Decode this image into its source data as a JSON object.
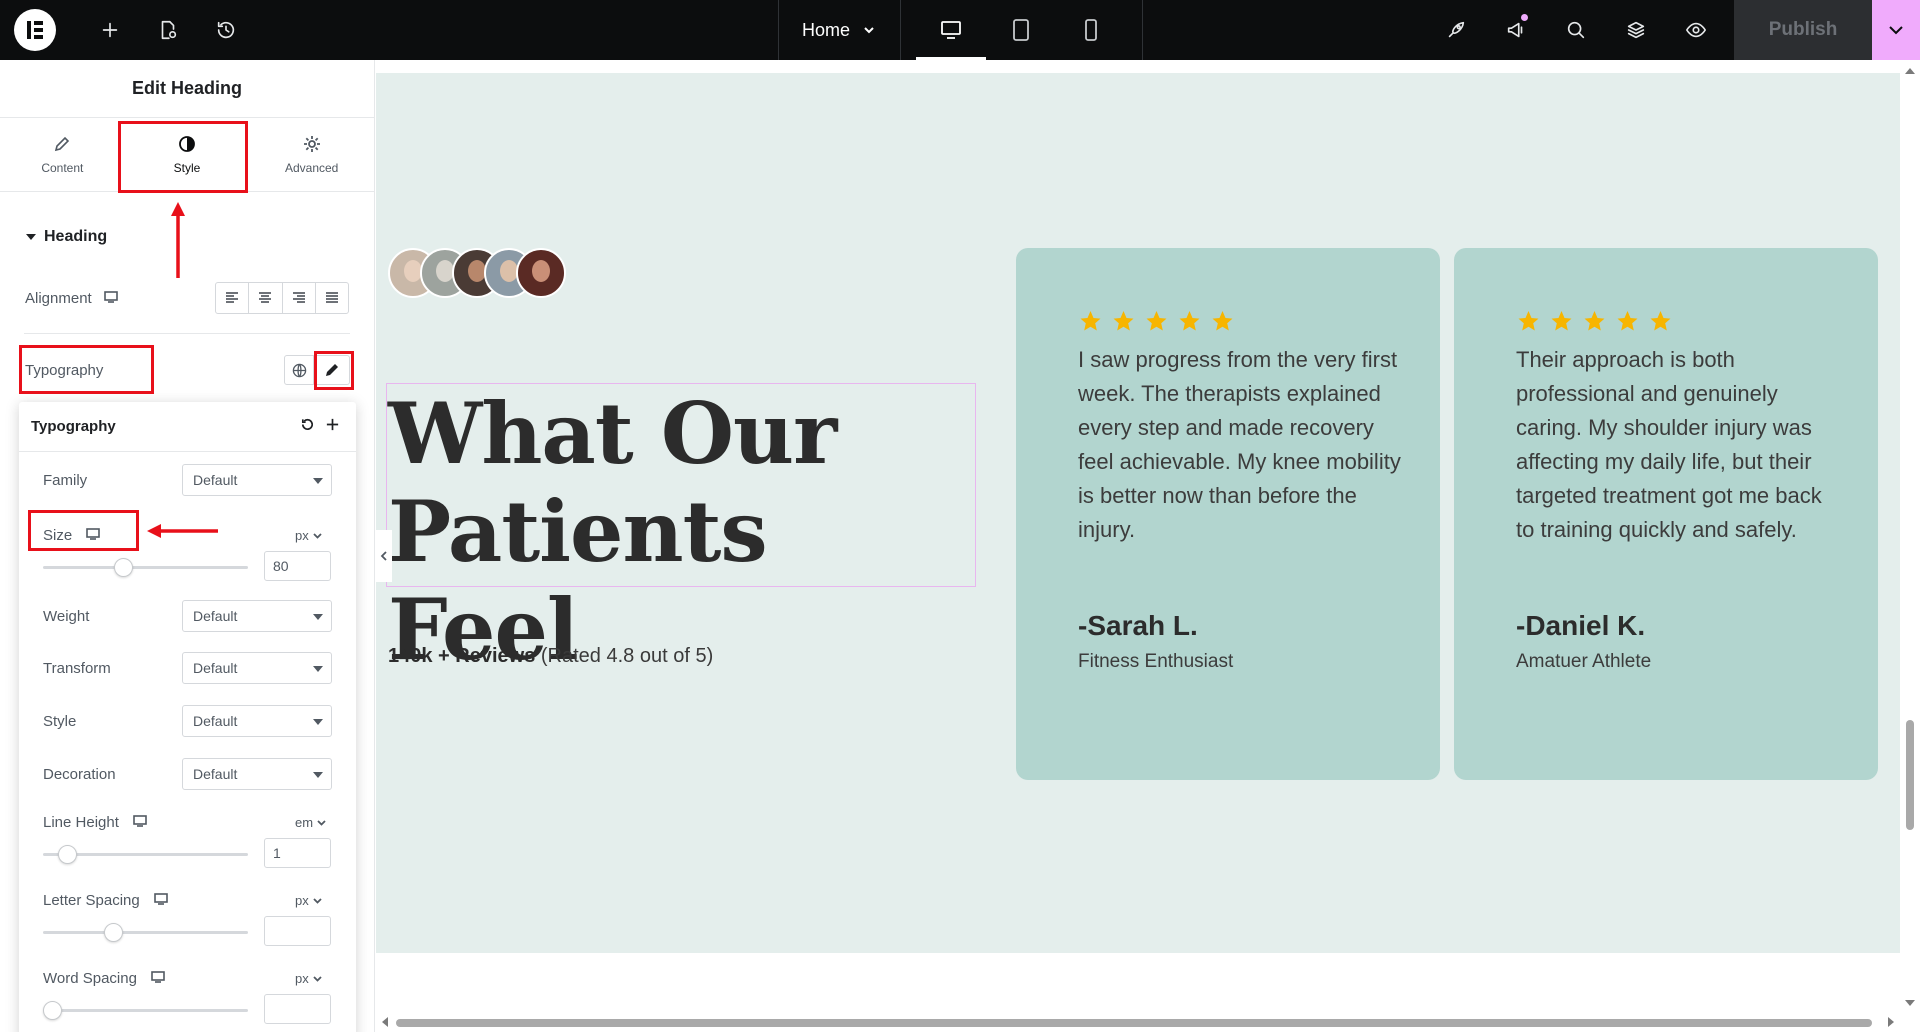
{
  "topbar": {
    "page_select": "Home",
    "publish_label": "Publish",
    "colors": {
      "bar": "#0c0d0e",
      "accent": "#f0abfc"
    },
    "icons": [
      "add-icon",
      "page-settings-icon",
      "history-icon",
      "desktop-icon",
      "tablet-icon",
      "mobile-icon",
      "rocket-icon",
      "megaphone-icon",
      "search-icon",
      "layers-icon",
      "preview-eye-icon",
      "chevron-down-icon"
    ]
  },
  "panel": {
    "title": "Edit Heading",
    "tabs": [
      {
        "label": "Content",
        "icon": "pencil-icon"
      },
      {
        "label": "Style",
        "icon": "half-circle-icon"
      },
      {
        "label": "Advanced",
        "icon": "gear-icon"
      }
    ],
    "section_title": "Heading",
    "alignment_label": "Alignment",
    "typography_label": "Typography"
  },
  "typography_popover": {
    "title": "Typography",
    "family_label": "Family",
    "family_value": "Default",
    "size_label": "Size",
    "size_unit": "px",
    "size_value": "80",
    "size_slider_fraction": 0.38,
    "weight_label": "Weight",
    "weight_value": "Default",
    "transform_label": "Transform",
    "transform_value": "Default",
    "style_label": "Style",
    "style_value": "Default",
    "decoration_label": "Decoration",
    "decoration_value": "Default",
    "line_height_label": "Line Height",
    "line_height_unit": "em",
    "line_height_value": "1",
    "line_height_slider_fraction": 0.08,
    "letter_spacing_label": "Letter Spacing",
    "letter_spacing_unit": "px",
    "letter_spacing_value": "",
    "letter_spacing_slider_fraction": 0.33,
    "word_spacing_label": "Word Spacing",
    "word_spacing_unit": "px",
    "word_spacing_value": "",
    "word_spacing_slider_fraction": 0.0
  },
  "canvas": {
    "heading_line1": "What Our",
    "heading_line2": "Patients Feel",
    "reviews_bold": "140k + Reviews",
    "reviews_rest": " (Rated 4.8 out of 5)",
    "section_bg": "#e4eeec",
    "card_bg": "#b2d5cf",
    "star_color": "#f7b500",
    "testimonials": [
      {
        "stars": 5,
        "quote": "I saw progress from the very first week. The therapists explained every step and made recovery feel achievable. My knee mobility is better now than before the injury.",
        "author": "-Sarah L.",
        "role": "Fitness Enthusiast"
      },
      {
        "stars": 5,
        "quote": "Their approach is both professional and genuinely caring. My shoulder injury was affecting my daily life, but their targeted treatment got me back to training quickly and safely.",
        "author": "-Daniel K.",
        "role": "Amatuer Athlete"
      }
    ]
  }
}
